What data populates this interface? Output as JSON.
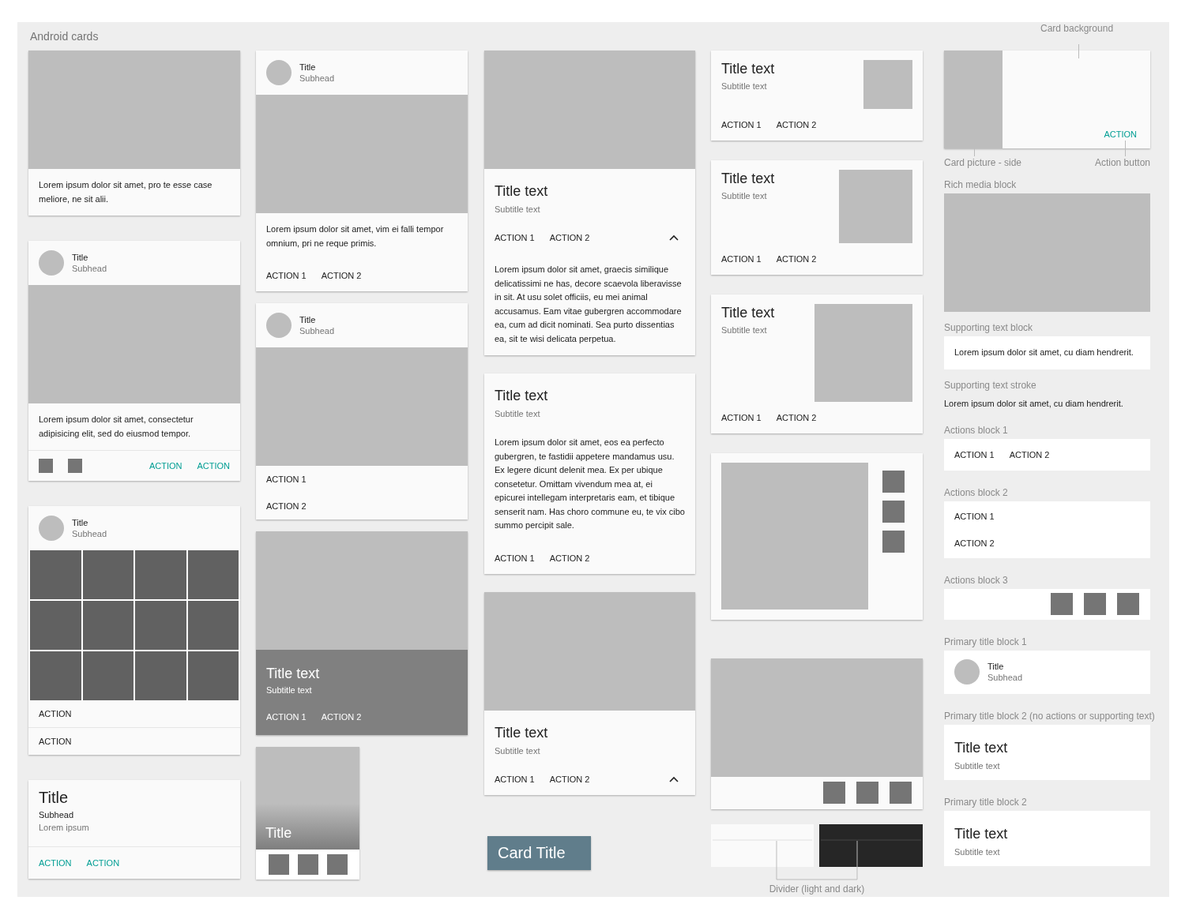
{
  "panel": {
    "title": "Android cards"
  },
  "columns": [
    {
      "cards": [
        {
          "kind": "card",
          "parts": [
            {
              "kind": "image"
            },
            {
              "kind": "text",
              "text": "Lorem ipsum dolor sit amet, pro te esse case meliore, ne sit alii."
            }
          ]
        },
        {
          "kind": "card",
          "parts": [
            {
              "kind": "header",
              "title": "Title",
              "subhead": "Subhead"
            },
            {
              "kind": "image"
            },
            {
              "kind": "text",
              "text": "Lorem ipsum dolor sit amet, consectetur adipisicing elit, sed do eiusmod tempor."
            },
            {
              "kind": "divider"
            },
            {
              "kind": "icon_actions",
              "icons": [
                {
                  "kind": "square"
                },
                {
                  "kind": "square"
                }
              ],
              "accent": true,
              "items": [
                "ACTION",
                "ACTION"
              ]
            }
          ]
        },
        {
          "kind": "card",
          "parts": [
            {
              "kind": "header",
              "title": "Title",
              "subhead": "Subhead"
            },
            {
              "kind": "grid",
              "cells": [
                {
                  "kind": "square"
                },
                {
                  "kind": "square"
                },
                {
                  "kind": "square"
                },
                {
                  "kind": "square"
                },
                {
                  "kind": "square"
                },
                {
                  "kind": "square"
                },
                {
                  "kind": "square"
                },
                {
                  "kind": "square"
                },
                {
                  "kind": "square"
                },
                {
                  "kind": "square"
                },
                {
                  "kind": "square"
                },
                {
                  "kind": "square"
                }
              ]
            },
            {
              "kind": "actions_stack",
              "accent": false,
              "items": [
                "ACTION"
              ]
            },
            {
              "kind": "divider"
            },
            {
              "kind": "actions_stack",
              "accent": false,
              "items": [
                "ACTION"
              ]
            }
          ]
        },
        {
          "kind": "card",
          "parts": [
            {
              "kind": "title_lines",
              "title": "Title",
              "subhead": "Subhead",
              "text": "Lorem ipsum"
            },
            {
              "kind": "divider"
            },
            {
              "kind": "actions_row",
              "accent": true,
              "items": [
                "ACTION",
                "ACTION"
              ]
            }
          ]
        }
      ]
    },
    {
      "cards": [
        {
          "kind": "card",
          "parts": [
            {
              "kind": "header",
              "title": "Title",
              "subhead": "Subhead"
            },
            {
              "kind": "image"
            },
            {
              "kind": "text",
              "text": "Lorem ipsum dolor sit amet, vim ei falli tempor omnium, pri ne reque primis."
            },
            {
              "kind": "actions_row",
              "accent": false,
              "items": [
                "ACTION 1",
                "ACTION 2"
              ]
            }
          ]
        },
        {
          "kind": "card",
          "parts": [
            {
              "kind": "header",
              "title": "Title",
              "subhead": "Subhead"
            },
            {
              "kind": "image"
            },
            {
              "kind": "actions_stack",
              "accent": false,
              "items": [
                "ACTION 1",
                "ACTION 2"
              ]
            }
          ]
        },
        {
          "kind": "card",
          "parts": [
            {
              "kind": "image"
            },
            {
              "kind": "overlay",
              "title": "Title text",
              "subtitle": "Subtitle text",
              "items": [
                "ACTION 1",
                "ACTION 2"
              ]
            }
          ]
        },
        {
          "kind": "tile",
          "parts": [
            {
              "kind": "tile_image",
              "title": "Title"
            },
            {
              "kind": "icons",
              "icons": [
                {
                  "kind": "square"
                },
                {
                  "kind": "square"
                },
                {
                  "kind": "square"
                }
              ]
            }
          ]
        }
      ]
    },
    {
      "cards": [
        {
          "kind": "card",
          "parts": [
            {
              "kind": "image"
            },
            {
              "kind": "title",
              "title": "Title text",
              "subtitle": "Subtitle text"
            },
            {
              "kind": "actions_row",
              "accent": false,
              "expanded": true,
              "items": [
                "ACTION 1",
                "ACTION 2"
              ]
            },
            {
              "kind": "text",
              "text": "Lorem ipsum dolor sit amet, graecis similique delicatissimi ne has, decore scaevola liberavisse in sit. At usu solet officiis, eu mei animal accusamus. Eam vitae gubergren accommodare ea, cum ad dicit nominati. Sea purto dissentias ea, sit te wisi delicata perpetua."
            }
          ]
        },
        {
          "kind": "card",
          "parts": [
            {
              "kind": "title",
              "title": "Title text",
              "subtitle": "Subtitle text"
            },
            {
              "kind": "text",
              "text": "Lorem ipsum dolor sit amet, eos ea perfecto gubergren, te fastidii appetere mandamus usu. Ex legere dicunt delenit mea. Ex per ubique consetetur. Omittam vivendum mea at, ei epicurei intellegam interpretaris eam, et tibique senserit nam. Has choro commune eu, te vix cibo summo percipit sale."
            },
            {
              "kind": "actions_row",
              "accent": false,
              "items": [
                "ACTION 1",
                "ACTION 2"
              ]
            }
          ]
        },
        {
          "kind": "card",
          "parts": [
            {
              "kind": "image"
            },
            {
              "kind": "title",
              "title": "Title text",
              "subtitle": "Subtitle text"
            },
            {
              "kind": "actions_row",
              "accent": false,
              "expanded": true,
              "items": [
                "ACTION 1",
                "ACTION 2"
              ]
            }
          ]
        },
        {
          "kind": "chip",
          "title": "Card Title"
        }
      ]
    },
    {
      "cards": [
        {
          "kind": "card",
          "parts": [
            {
              "kind": "thumb_title",
              "title": "Title text",
              "subtitle": "Subtitle text",
              "thumb": {
                "kind": "small"
              }
            },
            {
              "kind": "actions_row",
              "accent": false,
              "items": [
                "ACTION 1",
                "ACTION 2"
              ]
            }
          ]
        },
        {
          "kind": "card",
          "parts": [
            {
              "kind": "thumb_title",
              "title": "Title text",
              "subtitle": "Subtitle text",
              "thumb": {
                "kind": "medium"
              }
            },
            {
              "kind": "actions_row",
              "accent": false,
              "items": [
                "ACTION 1",
                "ACTION 2"
              ]
            }
          ]
        },
        {
          "kind": "card",
          "parts": [
            {
              "kind": "thumb_title",
              "title": "Title text",
              "subtitle": "Subtitle text",
              "thumb": {
                "kind": "large"
              }
            },
            {
              "kind": "actions_row",
              "accent": false,
              "items": [
                "ACTION 1",
                "ACTION 2"
              ]
            }
          ]
        },
        {
          "kind": "card",
          "parts": [
            {
              "kind": "side_icons",
              "icons": [
                {
                  "kind": "square"
                },
                {
                  "kind": "square"
                },
                {
                  "kind": "square"
                }
              ]
            }
          ]
        },
        {
          "kind": "card",
          "parts": [
            {
              "kind": "image"
            },
            {
              "kind": "icons",
              "icons": [
                {
                  "kind": "square"
                },
                {
                  "kind": "square"
                },
                {
                  "kind": "square"
                }
              ]
            }
          ]
        },
        {
          "kind": "divider_demo",
          "label": "Divider (light and dark)"
        }
      ]
    },
    {
      "cards": [
        {
          "kind": "annotated_card",
          "top_label": "Card background",
          "action": "ACTION",
          "picture_label": "Card picture - side",
          "action_label": "Action button"
        },
        {
          "kind": "label",
          "text": "Rich media block"
        },
        {
          "kind": "image"
        },
        {
          "kind": "label",
          "text": "Supporting text block"
        },
        {
          "kind": "block",
          "parts": [
            {
              "kind": "text",
              "text": "Lorem ipsum dolor sit amet, cu diam hendrerit."
            }
          ]
        },
        {
          "kind": "label",
          "text": "Supporting text stroke"
        },
        {
          "kind": "plain_text",
          "text": "Lorem ipsum dolor sit amet, cu diam hendrerit."
        },
        {
          "kind": "label",
          "text": "Actions block 1"
        },
        {
          "kind": "block",
          "parts": [
            {
              "kind": "actions_row",
              "accent": false,
              "items": [
                "ACTION 1",
                "ACTION 2"
              ]
            }
          ]
        },
        {
          "kind": "label",
          "text": "Actions block 2"
        },
        {
          "kind": "block",
          "parts": [
            {
              "kind": "actions_stack",
              "accent": false,
              "items": [
                "ACTION 1",
                "ACTION 2"
              ]
            }
          ]
        },
        {
          "kind": "label",
          "text": "Actions block 3"
        },
        {
          "kind": "block",
          "parts": [
            {
              "kind": "icons",
              "icons": [
                {
                  "kind": "square"
                },
                {
                  "kind": "square"
                },
                {
                  "kind": "square"
                }
              ]
            }
          ]
        },
        {
          "kind": "label",
          "text": "Primary title block 1"
        },
        {
          "kind": "block",
          "parts": [
            {
              "kind": "header",
              "title": "Title",
              "subhead": "Subhead"
            }
          ]
        },
        {
          "kind": "label",
          "text": "Primary title block 2 (no actions or supporting text)"
        },
        {
          "kind": "block",
          "parts": [
            {
              "kind": "title",
              "title": "Title text",
              "subtitle": "Subtitle text"
            }
          ]
        },
        {
          "kind": "label",
          "text": "Primary title block 2"
        },
        {
          "kind": "block",
          "parts": [
            {
              "kind": "title",
              "title": "Title text",
              "subtitle": "Subtitle text"
            }
          ]
        }
      ]
    }
  ]
}
